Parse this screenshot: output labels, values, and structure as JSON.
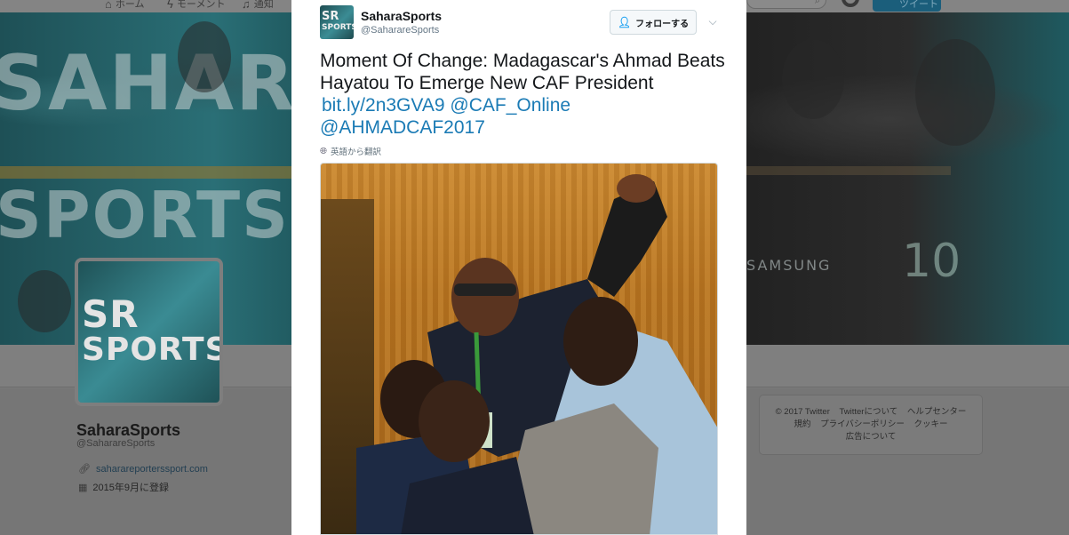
{
  "topnav": {
    "items": [
      {
        "label": "ホーム",
        "icon": "home-icon"
      },
      {
        "label": "モーメント",
        "icon": "lightning-icon"
      },
      {
        "label": "通知",
        "icon": "bell-icon"
      }
    ],
    "tweet_button_label": "ツイート"
  },
  "banner": {
    "word1": "SAHAR",
    "word2": "SPORTS"
  },
  "profile": {
    "avatar_text_top": "SR",
    "avatar_text_bottom": "SPORTS",
    "name": "SaharaSports",
    "handle": "@SaharareSports",
    "url": "saharareporterssport.com",
    "joined": "2015年9月に登録"
  },
  "footer": {
    "line1": [
      "© 2017 Twitter",
      "Twitterについて",
      "ヘルプセンター"
    ],
    "line2": [
      "規約",
      "プライバシーポリシー",
      "クッキー"
    ],
    "line3": [
      "広告について"
    ]
  },
  "tweet": {
    "author_name": "SaharaSports",
    "author_handle": "@SaharareSports",
    "avatar_text_top": "SR",
    "avatar_text_bottom": "SPORTS",
    "follow_label": "フォローする",
    "text": "Moment Of Change: Madagascar's Ahmad Beats Hayatou To Emerge New CAF President",
    "links": [
      "bit.ly/2n3GVA9",
      "@CAF_Online",
      "@AHMADCAF2017"
    ],
    "translate_label": "英語から翻訳",
    "photo_alt": "Ahmad raised in celebration"
  },
  "colors": {
    "link": "#1b7bb5",
    "follow_icon": "#1da1f2",
    "overlay": "#7b7b7b"
  }
}
